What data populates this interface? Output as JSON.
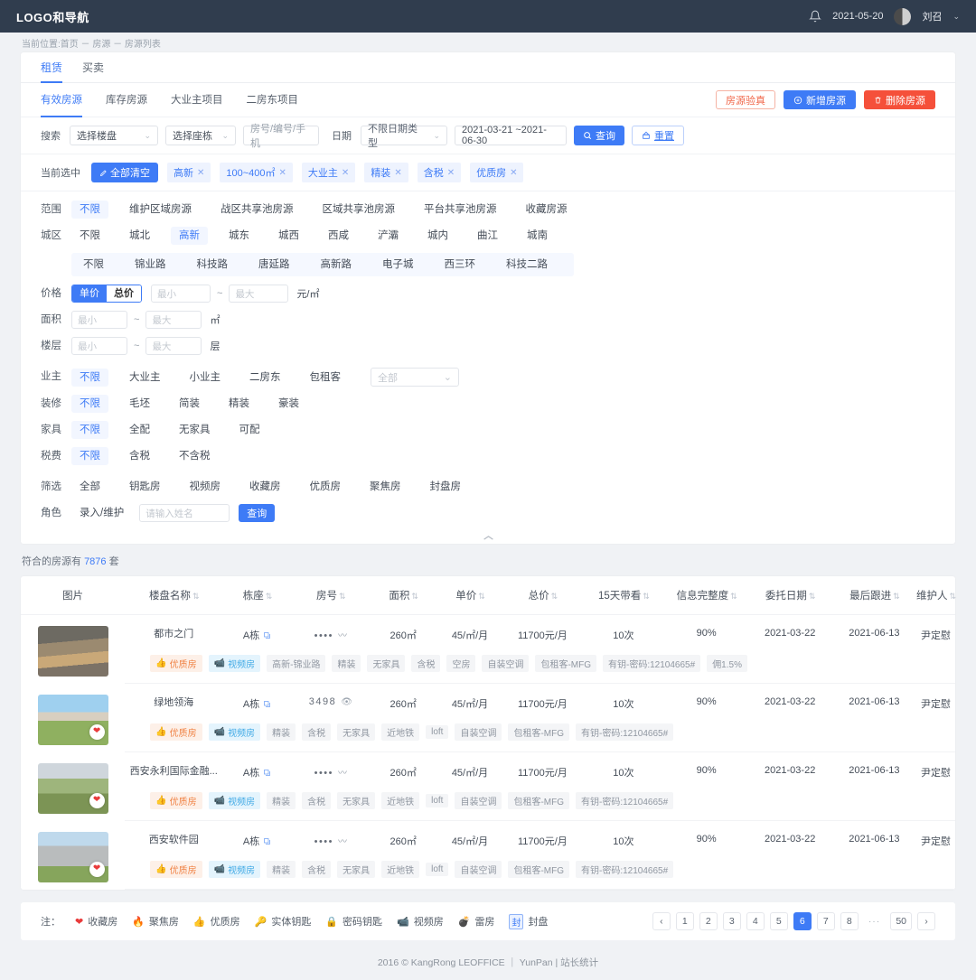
{
  "topbar": {
    "logo": "LOGO和导航",
    "date": "2021-05-20",
    "user": "刘召",
    "bell_icon": "bell-icon",
    "caret_icon": "chevron-down-icon"
  },
  "breadcrumb": "当前位置:首页 － 房源 － 房源列表",
  "tabs_main": [
    {
      "label": "租赁",
      "active": true
    },
    {
      "label": "买卖",
      "active": false
    }
  ],
  "tabs_sub": [
    {
      "label": "有效房源",
      "active": true
    },
    {
      "label": "库存房源",
      "active": false
    },
    {
      "label": "大业主项目",
      "active": false
    },
    {
      "label": "二房东项目",
      "active": false
    }
  ],
  "tab_actions": {
    "verify": "房源验真",
    "add": "新增房源",
    "delete": "删除房源"
  },
  "search": {
    "label": "搜索",
    "building_placeholder": "选择楼盘",
    "block_placeholder": "选择座栋",
    "house_placeholder": "房号/编号/手机",
    "date_label": "日期",
    "date_type_placeholder": "不限日期类型",
    "date_range": "2021-03-21 ~2021-06-30",
    "query": "查询",
    "reset": "重置"
  },
  "selected": {
    "label": "当前选中",
    "clear_all": "全部清空",
    "chips": [
      "高新",
      "100~400㎡",
      "大业主",
      "精装",
      "含税",
      "优质房"
    ]
  },
  "filters": [
    {
      "label": "范围",
      "options": [
        "不限",
        "维护区域房源",
        "战区共享池房源",
        "区域共享池房源",
        "平台共享池房源",
        "收藏房源"
      ],
      "selected": 0
    },
    {
      "label": "城区",
      "options": [
        "不限",
        "城北",
        "高新",
        "城东",
        "城西",
        "西咸",
        "浐灞",
        "城内",
        "曲江",
        "城南"
      ],
      "selected": 2
    }
  ],
  "sub_filter": {
    "options": [
      "不限",
      "锦业路",
      "科技路",
      "唐延路",
      "高新路",
      "电子城",
      "西三环",
      "科技二路"
    ],
    "selected": -1
  },
  "price": {
    "label": "价格",
    "toggle_on": "单价",
    "toggle_off": "总价",
    "min_placeholder": "最小",
    "max_placeholder": "最大",
    "unit": "元/㎡"
  },
  "area": {
    "label": "面积",
    "min_placeholder": "最小",
    "max_placeholder": "最大",
    "unit": "㎡"
  },
  "floor": {
    "label": "楼层",
    "min_placeholder": "最小",
    "max_placeholder": "最大",
    "unit": "层"
  },
  "owner": {
    "label": "业主",
    "options": [
      "不限",
      "大业主",
      "小业主",
      "二房东",
      "包租客"
    ],
    "selected": 0,
    "select_placeholder": "全部"
  },
  "decoration": {
    "label": "装修",
    "options": [
      "不限",
      "毛坯",
      "简装",
      "精装",
      "豪装"
    ],
    "selected": 0
  },
  "furniture": {
    "label": "家具",
    "options": [
      "不限",
      "全配",
      "无家具",
      "可配"
    ],
    "selected": 0
  },
  "tax": {
    "label": "税费",
    "options": [
      "不限",
      "含税",
      "不含税"
    ],
    "selected": 0
  },
  "screen": {
    "label": "筛选",
    "options": [
      "全部",
      "钥匙房",
      "视频房",
      "收藏房",
      "优质房",
      "聚焦房",
      "封盘房"
    ],
    "selected": -1
  },
  "role": {
    "label": "角色",
    "text": "录入/维护",
    "name_placeholder": "请输入姓名",
    "query": "查询"
  },
  "collapse_icon": "chevron-up-icon",
  "result": {
    "prefix": "符合的房源有",
    "count": "7876",
    "suffix": "套"
  },
  "table": {
    "columns": [
      {
        "label": "图片",
        "sortable": false
      },
      {
        "label": "楼盘名称",
        "sortable": true
      },
      {
        "label": "栋座",
        "sortable": true
      },
      {
        "label": "房号",
        "sortable": true
      },
      {
        "label": "面积",
        "sortable": true
      },
      {
        "label": "单价",
        "sortable": true
      },
      {
        "label": "总价",
        "sortable": true
      },
      {
        "label": "15天带看",
        "sortable": true
      },
      {
        "label": "信息完整度",
        "sortable": true
      },
      {
        "label": "委托日期",
        "sortable": true
      },
      {
        "label": "最后跟进",
        "sortable": true
      },
      {
        "label": "维护人",
        "sortable": true
      }
    ],
    "rows": [
      {
        "thumb_style": "mall",
        "has_heart": false,
        "name": "都市之门",
        "block": "A栋",
        "house_no": "••••",
        "house_icon": "eyebrow-icon",
        "area": "260㎡",
        "unit_price": "45/㎡/月",
        "total_price": "11700元/月",
        "visits": "10次",
        "completeness": "90%",
        "entrust_date": "2021-03-22",
        "last_follow": "2021-06-13",
        "maintainer": "尹定慰",
        "badges": [
          {
            "text": "优质房",
            "type": "orange",
            "icon": "thumbs-up-icon"
          },
          {
            "text": "视频房",
            "type": "blue",
            "icon": "video-icon"
          }
        ],
        "tags": [
          "高新-锦业路",
          "精装",
          "无家具",
          "含税",
          "空房",
          "自装空调",
          "包租客-MFG",
          "有钥-密码:12104665#",
          "佣1.5%"
        ]
      },
      {
        "thumb_style": "campus",
        "has_heart": true,
        "name": "绿地领海",
        "block": "A栋",
        "house_no": "3498",
        "house_icon": "eye-icon",
        "area": "260㎡",
        "unit_price": "45/㎡/月",
        "total_price": "11700元/月",
        "visits": "10次",
        "completeness": "90%",
        "entrust_date": "2021-03-22",
        "last_follow": "2021-06-13",
        "maintainer": "尹定慰",
        "badges": [
          {
            "text": "优质房",
            "type": "orange",
            "icon": "thumbs-up-icon"
          },
          {
            "text": "视频房",
            "type": "blue",
            "icon": "video-icon"
          }
        ],
        "tags": [
          "精装",
          "含税",
          "无家具",
          "近地铁",
          "loft",
          "自装空调",
          "包租客-MFG",
          "有钥-密码:12104665#"
        ]
      },
      {
        "thumb_style": "city",
        "has_heart": true,
        "name": "西安永利国际金融...",
        "block": "A栋",
        "house_no": "••••",
        "house_icon": "eyebrow-icon",
        "area": "260㎡",
        "unit_price": "45/㎡/月",
        "total_price": "11700元/月",
        "visits": "10次",
        "completeness": "90%",
        "entrust_date": "2021-03-22",
        "last_follow": "2021-06-13",
        "maintainer": "尹定慰",
        "badges": [
          {
            "text": "优质房",
            "type": "orange",
            "icon": "thumbs-up-icon"
          },
          {
            "text": "视频房",
            "type": "blue",
            "icon": "video-icon"
          }
        ],
        "tags": [
          "精装",
          "含税",
          "无家具",
          "近地铁",
          "loft",
          "自装空调",
          "包租客-MFG",
          "有钥-密码:12104665#"
        ]
      },
      {
        "thumb_style": "tower",
        "has_heart": true,
        "name": "西安软件园",
        "block": "A栋",
        "house_no": "••••",
        "house_icon": "eyebrow-icon",
        "area": "260㎡",
        "unit_price": "45/㎡/月",
        "total_price": "11700元/月",
        "visits": "10次",
        "completeness": "90%",
        "entrust_date": "2021-03-22",
        "last_follow": "2021-06-13",
        "maintainer": "尹定慰",
        "badges": [
          {
            "text": "优质房",
            "type": "orange",
            "icon": "thumbs-up-icon"
          },
          {
            "text": "视频房",
            "type": "blue",
            "icon": "video-icon"
          }
        ],
        "tags": [
          "精装",
          "含税",
          "无家具",
          "近地铁",
          "loft",
          "自装空调",
          "包租客-MFG",
          "有钥-密码:12104665#"
        ]
      }
    ]
  },
  "legend": {
    "label": "注：",
    "items": [
      {
        "text": "收藏房",
        "icon": "heart-icon",
        "color": "#e93b3b"
      },
      {
        "text": "聚焦房",
        "icon": "flame-icon",
        "color": "#f0674a"
      },
      {
        "text": "优质房",
        "icon": "thumbs-up-icon",
        "color": "#f08244"
      },
      {
        "text": "实体钥匙",
        "icon": "key-icon",
        "color": "#6fbf3f"
      },
      {
        "text": "密码钥匙",
        "icon": "lock-icon",
        "color": "#24b89a"
      },
      {
        "text": "视频房",
        "icon": "video-icon",
        "color": "#3fa9e5"
      },
      {
        "text": "雷房",
        "icon": "bomb-icon",
        "color": "#e93b3b"
      },
      {
        "text": "封盘",
        "icon": "seal-icon",
        "color": "#3e7bf6"
      }
    ]
  },
  "pagination": {
    "prev": "‹",
    "next": "›",
    "pages": [
      "1",
      "2",
      "3",
      "4",
      "5",
      "6",
      "7",
      "8"
    ],
    "ellipsis": "···",
    "last": "50",
    "current": "6"
  },
  "footer": "2016 © KangRong LEOFFICE ｜ YunPan | 站长统计"
}
